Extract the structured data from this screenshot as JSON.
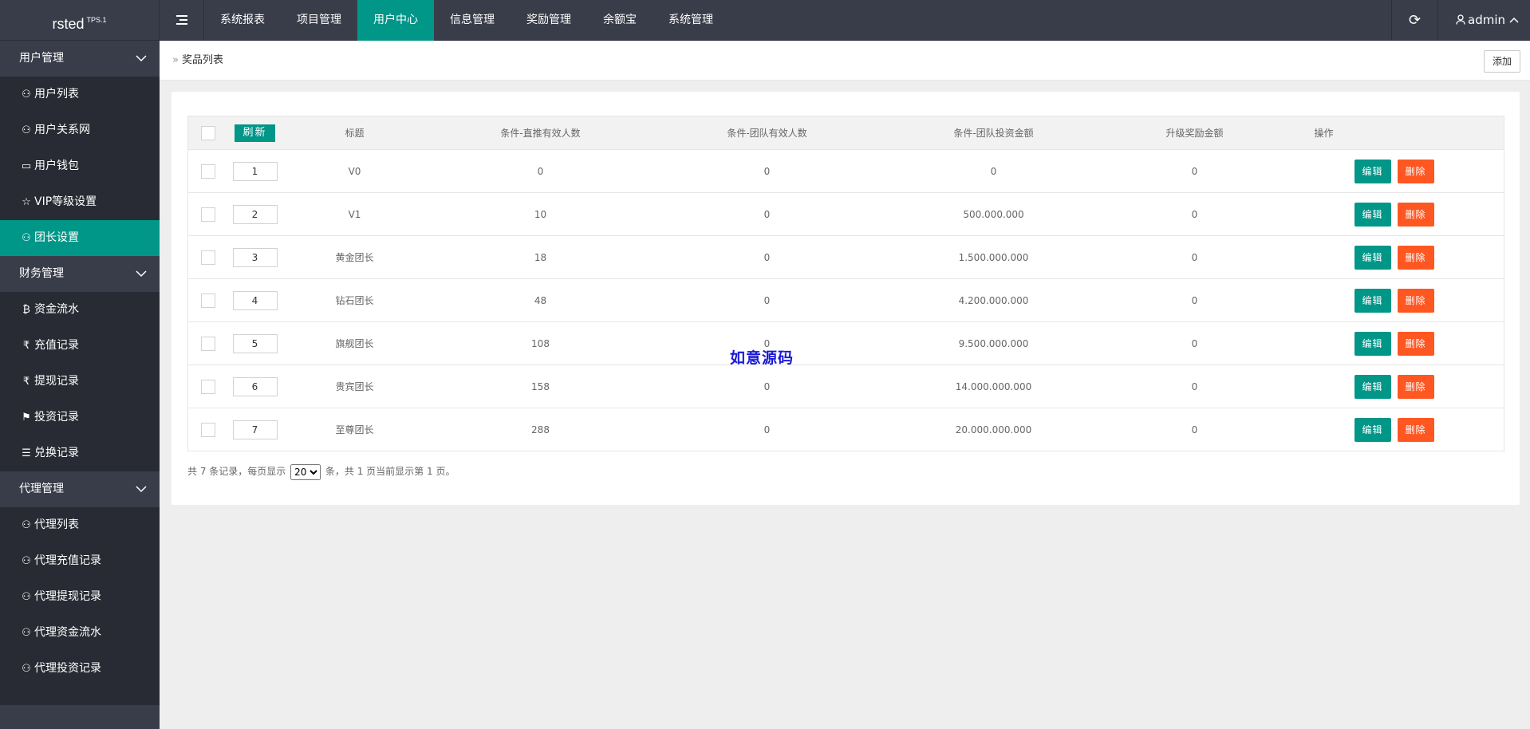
{
  "app": {
    "logo": "rsted",
    "version": "TPS.1"
  },
  "topnav": {
    "items": [
      {
        "label": "系统报表",
        "active": false
      },
      {
        "label": "项目管理",
        "active": false
      },
      {
        "label": "用户中心",
        "active": true
      },
      {
        "label": "信息管理",
        "active": false
      },
      {
        "label": "奖励管理",
        "active": false
      },
      {
        "label": "余额宝",
        "active": false
      },
      {
        "label": "系统管理",
        "active": false
      }
    ],
    "refresh_icon": "⟳",
    "user": "admin"
  },
  "sidebar": {
    "groups": [
      {
        "label": "用户管理",
        "items": [
          {
            "label": "用户列表",
            "icon": "user-icon",
            "active": false
          },
          {
            "label": "用户关系网",
            "icon": "users-icon",
            "active": false
          },
          {
            "label": "用户钱包",
            "icon": "wallet-icon",
            "active": false
          },
          {
            "label": "VIP等级设置",
            "icon": "star-icon",
            "active": false
          },
          {
            "label": "团长设置",
            "icon": "users-icon",
            "active": true
          }
        ]
      },
      {
        "label": "财务管理",
        "items": [
          {
            "label": "资金流水",
            "icon": "bitcoin-icon",
            "active": false
          },
          {
            "label": "充值记录",
            "icon": "rupee-icon",
            "active": false
          },
          {
            "label": "提现记录",
            "icon": "rupee-icon",
            "active": false
          },
          {
            "label": "投资记录",
            "icon": "flag-icon",
            "active": false
          },
          {
            "label": "兑换记录",
            "icon": "list-icon",
            "active": false
          }
        ]
      },
      {
        "label": "代理管理",
        "items": [
          {
            "label": "代理列表",
            "icon": "user-icon",
            "active": false
          },
          {
            "label": "代理充值记录",
            "icon": "user-icon",
            "active": false
          },
          {
            "label": "代理提现记录",
            "icon": "user-icon",
            "active": false
          },
          {
            "label": "代理资金流水",
            "icon": "user-icon",
            "active": false
          },
          {
            "label": "代理投资记录",
            "icon": "user-icon",
            "active": false
          }
        ]
      }
    ]
  },
  "page": {
    "breadcrumb": "奖品列表",
    "add_label": "添加"
  },
  "table": {
    "refresh_label": "刷新",
    "headers": [
      "标题",
      "条件-直推有效人数",
      "条件-团队有效人数",
      "条件-团队投资金额",
      "升级奖励金额",
      "操作"
    ],
    "edit_label": "编辑",
    "delete_label": "删除",
    "rows": [
      {
        "sort": "1",
        "title": "V0",
        "direct": "0",
        "team": "0",
        "invest": "0",
        "reward": "0"
      },
      {
        "sort": "2",
        "title": "V1",
        "direct": "10",
        "team": "0",
        "invest": "500.000.000",
        "reward": "0"
      },
      {
        "sort": "3",
        "title": "黄金团长",
        "direct": "18",
        "team": "0",
        "invest": "1.500.000.000",
        "reward": "0"
      },
      {
        "sort": "4",
        "title": "钻石团长",
        "direct": "48",
        "team": "0",
        "invest": "4.200.000.000",
        "reward": "0"
      },
      {
        "sort": "5",
        "title": "旗舰团长",
        "direct": "108",
        "team": "0",
        "invest": "9.500.000.000",
        "reward": "0"
      },
      {
        "sort": "6",
        "title": "贵宾团长",
        "direct": "158",
        "team": "0",
        "invest": "14.000.000.000",
        "reward": "0"
      },
      {
        "sort": "7",
        "title": "至尊团长",
        "direct": "288",
        "team": "0",
        "invest": "20.000.000.000",
        "reward": "0"
      }
    ]
  },
  "pager": {
    "prefix": "共 7 条记录，每页显示",
    "page_size": "20",
    "suffix": "条，共 1 页当前显示第 1 页。"
  },
  "watermark": "如意源码",
  "colors": {
    "accent": "#009688",
    "danger": "#ff5722",
    "dark": "#393d49"
  }
}
